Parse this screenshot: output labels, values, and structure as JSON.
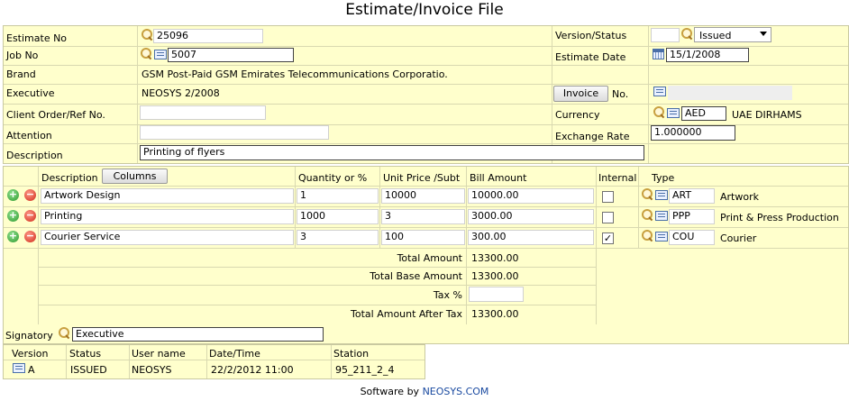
{
  "page": {
    "title": "Estimate/Invoice File"
  },
  "header": {
    "estimate_no_label": "Estimate No",
    "estimate_no_value": "25096",
    "job_no_label": "Job No",
    "job_no_value": "5007",
    "brand_label": "Brand",
    "brand_value": "GSM Post-Paid  GSM  Emirates Telecommunications Corporatio.",
    "executive_label": "Executive",
    "executive_value": "NEOSYS  2/2008",
    "client_order_label": "Client Order/Ref No.",
    "client_order_value": "",
    "attention_label": "Attention",
    "attention_value": "",
    "description_label": "Description",
    "description_value": "Printing of flyers",
    "version_status_label": "Version/Status",
    "version_status_value": "",
    "status_selected": "Issued",
    "estimate_date_label": "Estimate Date",
    "estimate_date_value": "15/1/2008",
    "invoice_button": "Invoice",
    "invoice_no_label": "No.",
    "invoice_no_value": "",
    "currency_label": "Currency",
    "currency_code": "AED",
    "currency_name": "UAE DIRHAMS",
    "exchange_rate_label": "Exchange Rate",
    "exchange_rate_value": "1.000000"
  },
  "lines": {
    "columns": {
      "description": "Description",
      "columns_button": "Columns",
      "quantity": "Quantity or %",
      "unit_price": "Unit Price /Subt",
      "bill_amount": "Bill Amount",
      "internal": "Internal",
      "type": "Type"
    },
    "rows": [
      {
        "description": "Artwork Design",
        "quantity": "1",
        "unit_price": "10000",
        "bill_amount": "10000.00",
        "internal": false,
        "type_code": "ART",
        "type_name": "Artwork"
      },
      {
        "description": "Printing",
        "quantity": "1000",
        "unit_price": "3",
        "bill_amount": "3000.00",
        "internal": false,
        "type_code": "PPP",
        "type_name": "Print & Press Production"
      },
      {
        "description": "Courier Service",
        "quantity": "3",
        "unit_price": "100",
        "bill_amount": "300.00",
        "internal": true,
        "type_code": "COU",
        "type_name": "Courier"
      }
    ],
    "totals": {
      "total_amount_label": "Total Amount",
      "total_amount": "13300.00",
      "total_base_label": "Total Base Amount",
      "total_base": "13300.00",
      "tax_label": "Tax %",
      "tax_value": "",
      "after_tax_label": "Total Amount After Tax",
      "after_tax": "13300.00"
    }
  },
  "signatory": {
    "label": "Signatory",
    "value": "Executive"
  },
  "versions": {
    "columns": [
      "Version",
      "Status",
      "User name",
      "Date/Time",
      "Station"
    ],
    "rows": [
      {
        "version": "A",
        "status": "ISSUED",
        "user": "NEOSYS",
        "datetime": "22/2/2012 11:00",
        "station": "95_211_2_4"
      }
    ]
  },
  "footer": {
    "prefix": "Software by ",
    "link": "NEOSYS.COM"
  },
  "colors": {
    "panel": "#ffffcc",
    "link": "#1a4aa0",
    "plus": "#2f9a2f",
    "minus": "#d02a1a"
  }
}
